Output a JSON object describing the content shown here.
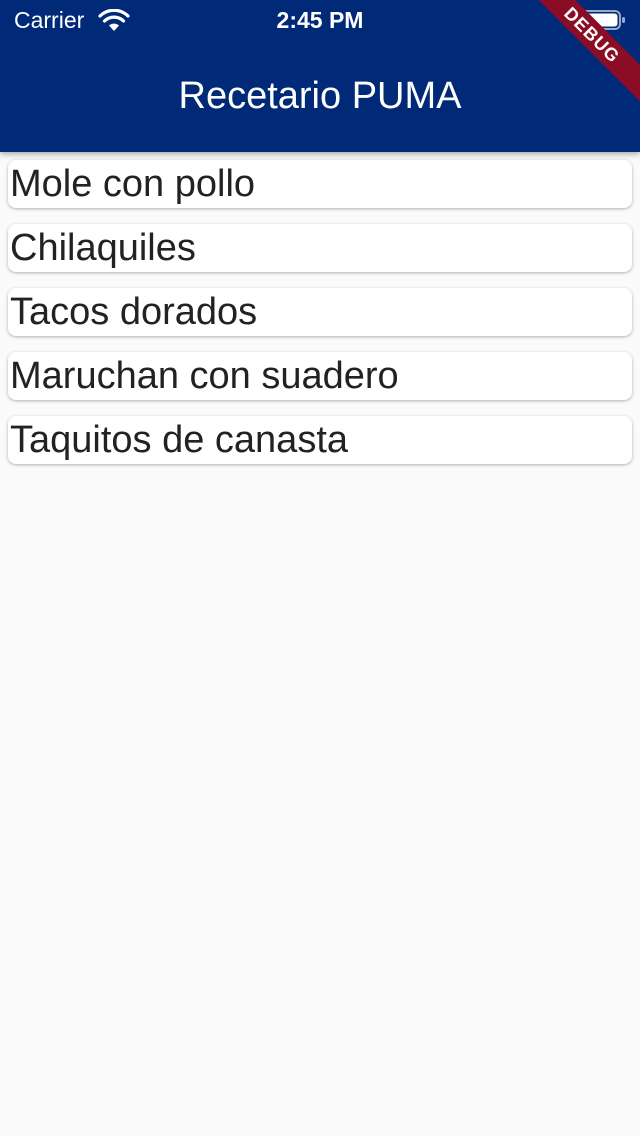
{
  "status_bar": {
    "carrier": "Carrier",
    "time": "2:45 PM"
  },
  "app_bar": {
    "title": "Recetario PUMA",
    "background_color": "#002A78"
  },
  "debug_banner": {
    "label": "DEBUG",
    "color": "#8B0D25"
  },
  "recipes": [
    {
      "label": "Mole con pollo"
    },
    {
      "label": "Chilaquiles"
    },
    {
      "label": "Tacos dorados"
    },
    {
      "label": "Maruchan con suadero"
    },
    {
      "label": "Taquitos de canasta"
    }
  ]
}
